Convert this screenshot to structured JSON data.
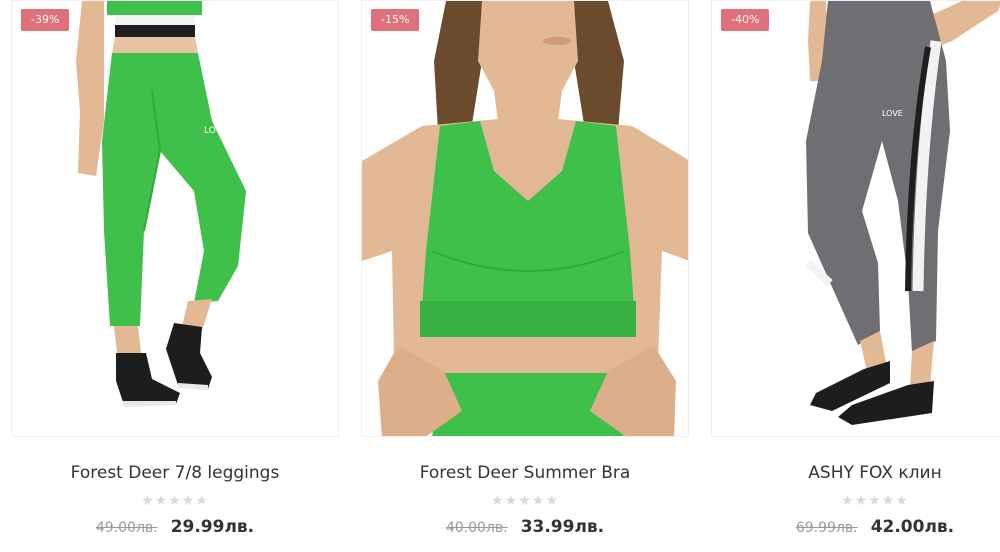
{
  "products": [
    {
      "name": "Forest Deer 7/8 leggings",
      "discount": "-39%",
      "old_price": "49.00лв.",
      "new_price": "29.99лв.",
      "stars": "★★★★★",
      "image_icon": "green-leggings-photo",
      "badge_color": "#e07178"
    },
    {
      "name": "Forest Deer Summer Bra",
      "discount": "-15%",
      "old_price": "40.00лв.",
      "new_price": "33.99лв.",
      "stars": "★★★★★",
      "image_icon": "green-sports-bra-photo",
      "badge_color": "#e07178"
    },
    {
      "name": "ASHY FOX клин",
      "discount": "-40%",
      "old_price": "69.99лв.",
      "new_price": "42.00лв.",
      "stars": "★★★★★",
      "image_icon": "grey-leggings-photo",
      "badge_color": "#e07178"
    }
  ],
  "colors": {
    "product_green": "#3ec04a",
    "product_grey": "#6d6f73",
    "star_empty": "#d9d9d9"
  }
}
